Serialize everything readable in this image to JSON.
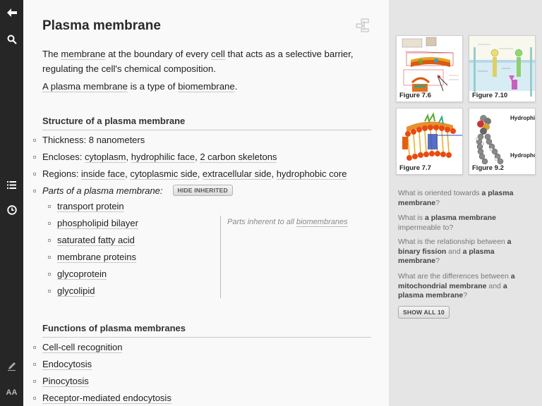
{
  "toolbar": {
    "icons": [
      "back-arrow-icon",
      "search-icon",
      "list-icon",
      "history-clock-icon",
      "pencil-icon",
      "font-size-icon"
    ],
    "font_label": "AA"
  },
  "concept": {
    "title": "Plasma membrane",
    "definition": {
      "t1": "The ",
      "l1": "membrane",
      "t2": " at the boundary of every ",
      "l2": "cell",
      "t3": " that acts as a selective barrier, regulating the cell's chemical composition."
    },
    "type_of": {
      "l1": "A plasma membrane",
      "t1": " is a type of ",
      "l2": "biomembrane",
      "t2": "."
    }
  },
  "structure": {
    "heading": "Structure of a plasma membrane",
    "thickness": {
      "label": "Thickness: ",
      "value": "8 nanometers"
    },
    "encloses": {
      "label": "Encloses: ",
      "items": [
        "cytoplasm",
        "hydrophilic face",
        "2 carbon skeletons"
      ]
    },
    "regions": {
      "label": "Regions: ",
      "items": [
        "inside face",
        "cytoplasmic side",
        "extracellular side",
        "hydrophobic core"
      ]
    },
    "parts": {
      "label": "Parts of a plasma membrane:",
      "hide_button": "HIDE INHERITED",
      "items": [
        "transport protein",
        "phospholipid bilayer",
        "saturated fatty acid",
        "membrane proteins",
        "glycoprotein",
        "glycolipid"
      ],
      "inherited_note": "Parts inherent to all ",
      "inherited_link": "biomembranes"
    }
  },
  "functions": {
    "heading": "Functions of plasma membranes",
    "items": [
      "Cell-cell recognition",
      "Endocytosis",
      "Pinocytosis",
      "Receptor-mediated endocytosis"
    ]
  },
  "figures": [
    {
      "label": "Figure 7.6"
    },
    {
      "label": "Figure 7.10"
    },
    {
      "label": "Figure 7.7"
    },
    {
      "label": "Figure 9.2",
      "overlay_text_1": "Hydrophil",
      "overlay_text_2": "Hydrophob"
    }
  ],
  "questions": [
    {
      "t1": "What is oriented towards ",
      "b1": "a plasma membrane",
      "t2": "?"
    },
    {
      "t1": "What is ",
      "b1": "a plasma membrane",
      "t2": " impermeable to?"
    },
    {
      "t1": "What is the relationship between ",
      "b1": "a binary fission",
      "t2": " and ",
      "b2": "a plasma membrane",
      "t3": "?"
    },
    {
      "t1": "What are the differences between ",
      "b1": "a mitochondrial membrane",
      "t2": " and ",
      "b2": "a plasma membrane",
      "t3": "?"
    }
  ],
  "show_all_button": "SHOW ALL 10"
}
